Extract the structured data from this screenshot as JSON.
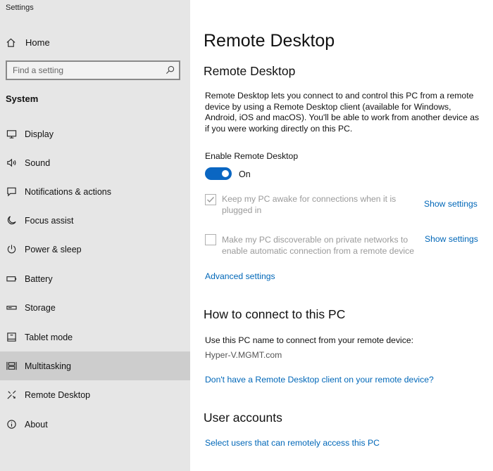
{
  "window": {
    "title": "Settings"
  },
  "sidebar": {
    "home_label": "Home",
    "search_placeholder": "Find a setting",
    "section_label": "System",
    "items": [
      {
        "label": "Display",
        "icon": "display-icon"
      },
      {
        "label": "Sound",
        "icon": "speaker-icon"
      },
      {
        "label": "Notifications & actions",
        "icon": "notification-icon"
      },
      {
        "label": "Focus assist",
        "icon": "moon-icon"
      },
      {
        "label": "Power & sleep",
        "icon": "power-icon"
      },
      {
        "label": "Battery",
        "icon": "battery-icon"
      },
      {
        "label": "Storage",
        "icon": "storage-icon"
      },
      {
        "label": "Tablet mode",
        "icon": "tablet-icon"
      },
      {
        "label": "Multitasking",
        "icon": "multitasking-icon",
        "active": true
      },
      {
        "label": "Remote Desktop",
        "icon": "remote-desktop-icon"
      },
      {
        "label": "About",
        "icon": "info-icon"
      }
    ]
  },
  "main": {
    "page_title": "Remote Desktop",
    "section1_heading": "Remote Desktop",
    "description": "Remote Desktop lets you connect to and control this PC from a remote device by using a Remote Desktop client (available for Windows, Android, iOS and macOS). You'll be able to work from another device as if you were working directly on this PC.",
    "enable_label": "Enable Remote Desktop",
    "toggle_state": "On",
    "option_awake": {
      "label": "Keep my PC awake for connections when it is plugged in",
      "checked": true,
      "link": "Show settings"
    },
    "option_discoverable": {
      "label": "Make my PC discoverable on private networks to enable automatic connection from a remote device",
      "checked": false,
      "link": "Show settings"
    },
    "advanced_link": "Advanced settings",
    "connect_heading": "How to connect to this PC",
    "connect_instruction": "Use this PC name to connect from your remote device:",
    "pc_name": "Hyper-V.MGMT.com",
    "client_link": "Don't have a Remote Desktop client on your remote device?",
    "accounts_heading": "User accounts",
    "accounts_link": "Select users that can remotely access this PC"
  },
  "colors": {
    "accent": "#0a66c2",
    "link": "#0067b8",
    "sidebar_bg": "#e6e6e6",
    "active_item_bg": "#cdcdcd"
  }
}
